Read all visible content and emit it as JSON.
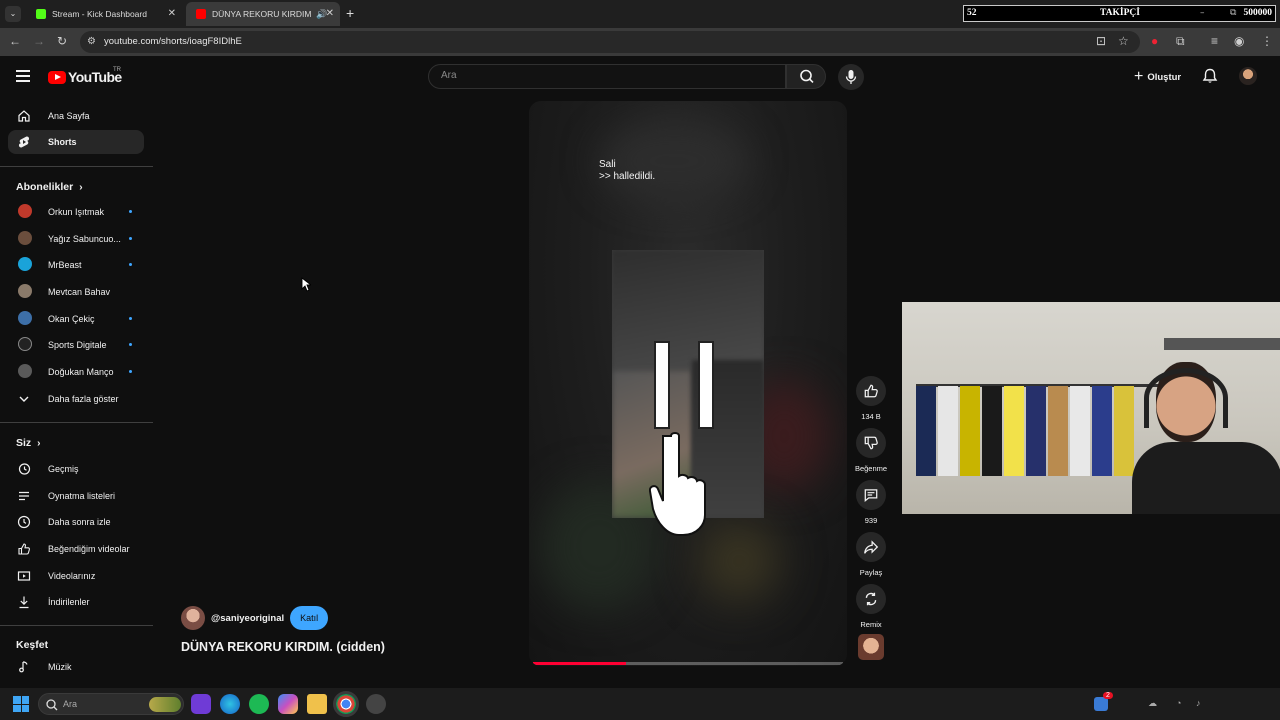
{
  "browser": {
    "tabs": [
      {
        "label": "Stream - Kick Dashboard",
        "favicon_color": "#53fc18"
      },
      {
        "label": "DÜNYA REKORU KIRDIM. (c",
        "favicon_color": "#ff0000"
      }
    ],
    "url": "youtube.com/shorts/ioagF8IDlhE"
  },
  "overlay": {
    "current": "52",
    "label": "TAKİPÇİ",
    "goal": "500000"
  },
  "header": {
    "logo_text": "YouTube",
    "country_code": "TR",
    "search_placeholder": "Ara",
    "create_label": "Oluştur"
  },
  "sidebar": {
    "main": [
      {
        "label": "Ana Sayfa",
        "icon": "home-icon"
      },
      {
        "label": "Shorts",
        "icon": "shorts-icon",
        "active": true
      }
    ],
    "subscriptions_title": "Abonelikler",
    "subscriptions": [
      {
        "label": "Orkun Işıtmak",
        "color": "#c0392b"
      },
      {
        "label": "Yağız Sabuncuo...",
        "color": "#6b4e3d"
      },
      {
        "label": "MrBeast",
        "color": "#1aa3d9"
      },
      {
        "label": "Mevtcan Bahav",
        "color": "#8a7a6a"
      },
      {
        "label": "Okan Çekiç",
        "color": "#3d6fa8"
      },
      {
        "label": "Sports Digitale",
        "color": "#222222"
      },
      {
        "label": "Doğukan Manço",
        "color": "#5a5a5a"
      }
    ],
    "show_more": "Daha fazla göster",
    "you_title": "Siz",
    "you": [
      {
        "label": "Geçmiş",
        "icon": "history-icon"
      },
      {
        "label": "Oynatma listeleri",
        "icon": "playlists-icon"
      },
      {
        "label": "Daha sonra izle",
        "icon": "watch-later-icon"
      },
      {
        "label": "Beğendiğim videolar",
        "icon": "liked-videos-icon"
      },
      {
        "label": "Videolarınız",
        "icon": "your-videos-icon"
      },
      {
        "label": "İndirilenler",
        "icon": "downloads-icon"
      }
    ],
    "explore_title": "Keşfet",
    "explore": [
      {
        "label": "Müzik",
        "icon": "music-icon"
      }
    ]
  },
  "short": {
    "caption_line1": "Sali",
    "caption_line2": ">> halledildi.",
    "progress": 0.3,
    "channel_handle": "@saniyeoriginal",
    "join_label": "Katıl",
    "title": "DÜNYA REKORU KIRDIM. (cidden)",
    "like_count": "134 B",
    "dislike_label": "Beğenme",
    "comment_count": "939",
    "share_label": "Paylaş",
    "remix_label": "Remix"
  },
  "taskbar": {
    "search_placeholder": "Ara",
    "notification_count": "2"
  }
}
